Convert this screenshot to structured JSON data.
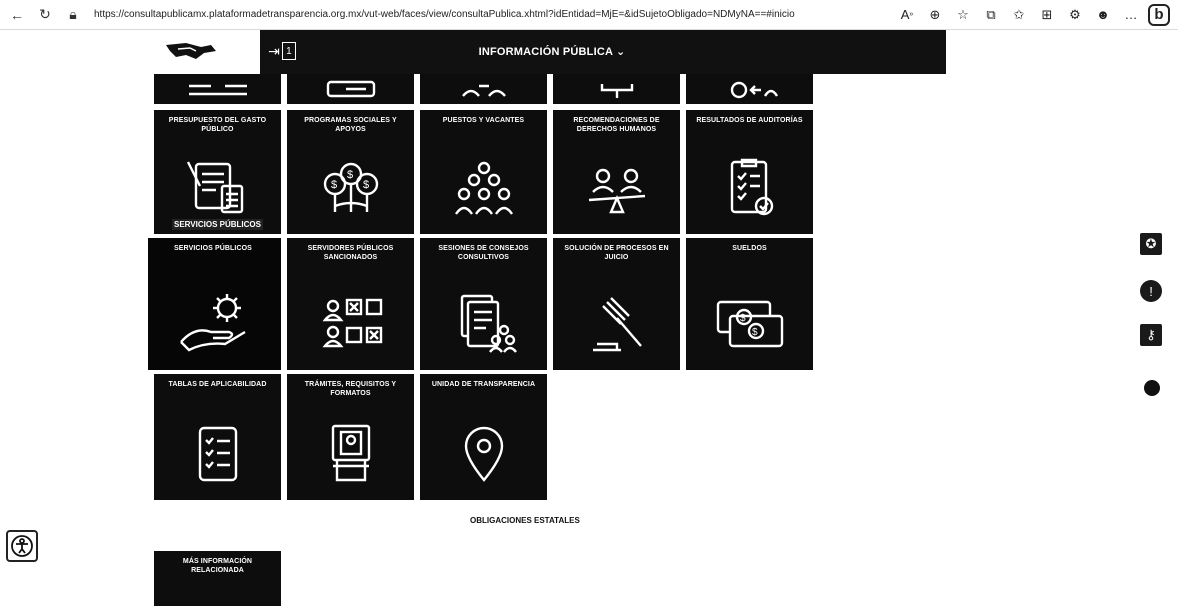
{
  "browser": {
    "url": "https://consultapublicamx.plataformadetransparencia.org.mx/vut-web/faces/view/consultaPublica.xhtml?idEntidad=MjE=&idSujetoObligado=NDMyNA==#inicio",
    "back_icon": "back-arrow-icon",
    "reload_icon": "reload-icon",
    "bing_label": "b"
  },
  "header": {
    "title": "INFORMACIÓN PÚBLICA ⌄",
    "menu_box_label": "1"
  },
  "tiles_top_row": [
    {
      "label": "",
      "icon": "network-icon"
    },
    {
      "label": "",
      "icon": "keyboard-icon"
    },
    {
      "label": "",
      "icon": "people-icon"
    },
    {
      "label": "",
      "icon": "branch-icon"
    },
    {
      "label": "",
      "icon": "exchange-icon"
    }
  ],
  "tiles": [
    {
      "label": "PRESUPUESTO DEL GASTO PÚBLICO",
      "icon": "budget-doc-icon"
    },
    {
      "label": "PROGRAMAS SOCIALES Y APOYOS",
      "icon": "money-tree-icon"
    },
    {
      "label": "PUESTOS Y VACANTES",
      "icon": "group-icon"
    },
    {
      "label": "RECOMENDACIONES DE DERECHOS HUMANOS",
      "icon": "balance-icon"
    },
    {
      "label": "RESULTADOS DE AUDITORÍAS",
      "icon": "clipboard-check-icon"
    },
    {
      "label": "SERVICIOS PÚBLICOS",
      "icon": "hand-gear-icon"
    },
    {
      "label": "SERVIDORES PÚBLICOS SANCIONADOS",
      "icon": "sanctioned-icon"
    },
    {
      "label": "SESIONES DE CONSEJOS CONSULTIVOS",
      "icon": "documents-people-icon"
    },
    {
      "label": "SOLUCIÓN DE PROCESOS EN JUICIO",
      "icon": "gavel-icon"
    },
    {
      "label": "SUELDOS",
      "icon": "money-bills-icon"
    },
    {
      "label": "TABLAS DE APLICABILIDAD",
      "icon": "checklist-icon"
    },
    {
      "label": "TRÁMITES, REQUISITOS Y FORMATOS",
      "icon": "kiosk-icon"
    },
    {
      "label": "UNIDAD DE TRANSPARENCIA",
      "icon": "location-pin-icon"
    }
  ],
  "hover_label": "SERVICIOS PÚBLICOS",
  "section": {
    "title": "OBLIGACIONES ESTATALES"
  },
  "more_info": {
    "label": "MÁS INFORMACIÓN RELACIONADA"
  },
  "side_icons": [
    "badge-icon",
    "alert-icon",
    "key-icon",
    "dot-icon"
  ]
}
